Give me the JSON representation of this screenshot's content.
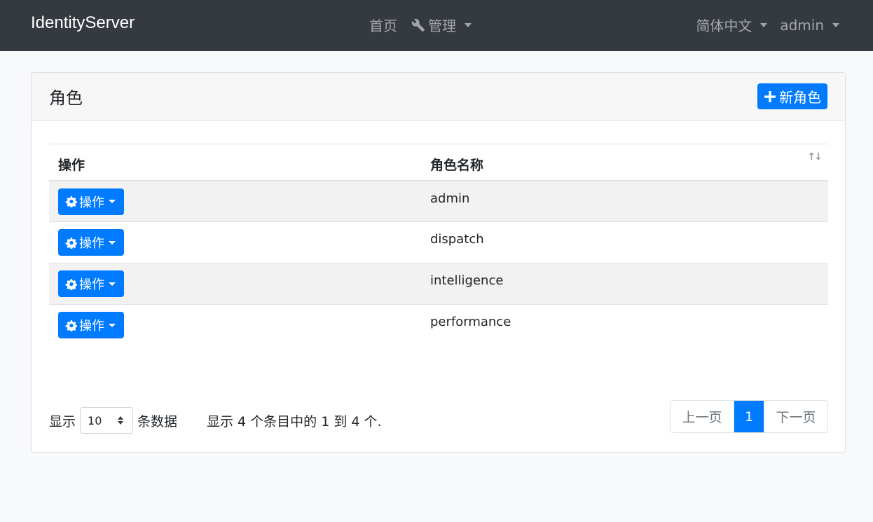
{
  "navbar": {
    "brand": "IdentityServer",
    "home": "首页",
    "manage": "管理",
    "language": "简体中文",
    "user": "admin"
  },
  "card": {
    "title": "角色",
    "new_button": "新角色"
  },
  "table": {
    "headers": [
      "操作",
      "角色名称"
    ],
    "action_label": "操作",
    "rows": [
      {
        "name": "admin"
      },
      {
        "name": "dispatch"
      },
      {
        "name": "intelligence"
      },
      {
        "name": "performance"
      }
    ]
  },
  "footer": {
    "show_prefix": "显示",
    "page_size": "10",
    "show_suffix": "条数据",
    "info": "显示 4 个条目中的 1 到 4 个.",
    "prev": "上一页",
    "current": "1",
    "next": "下一页"
  },
  "colors": {
    "navbar": "#343a40",
    "primary": "#007bff"
  }
}
